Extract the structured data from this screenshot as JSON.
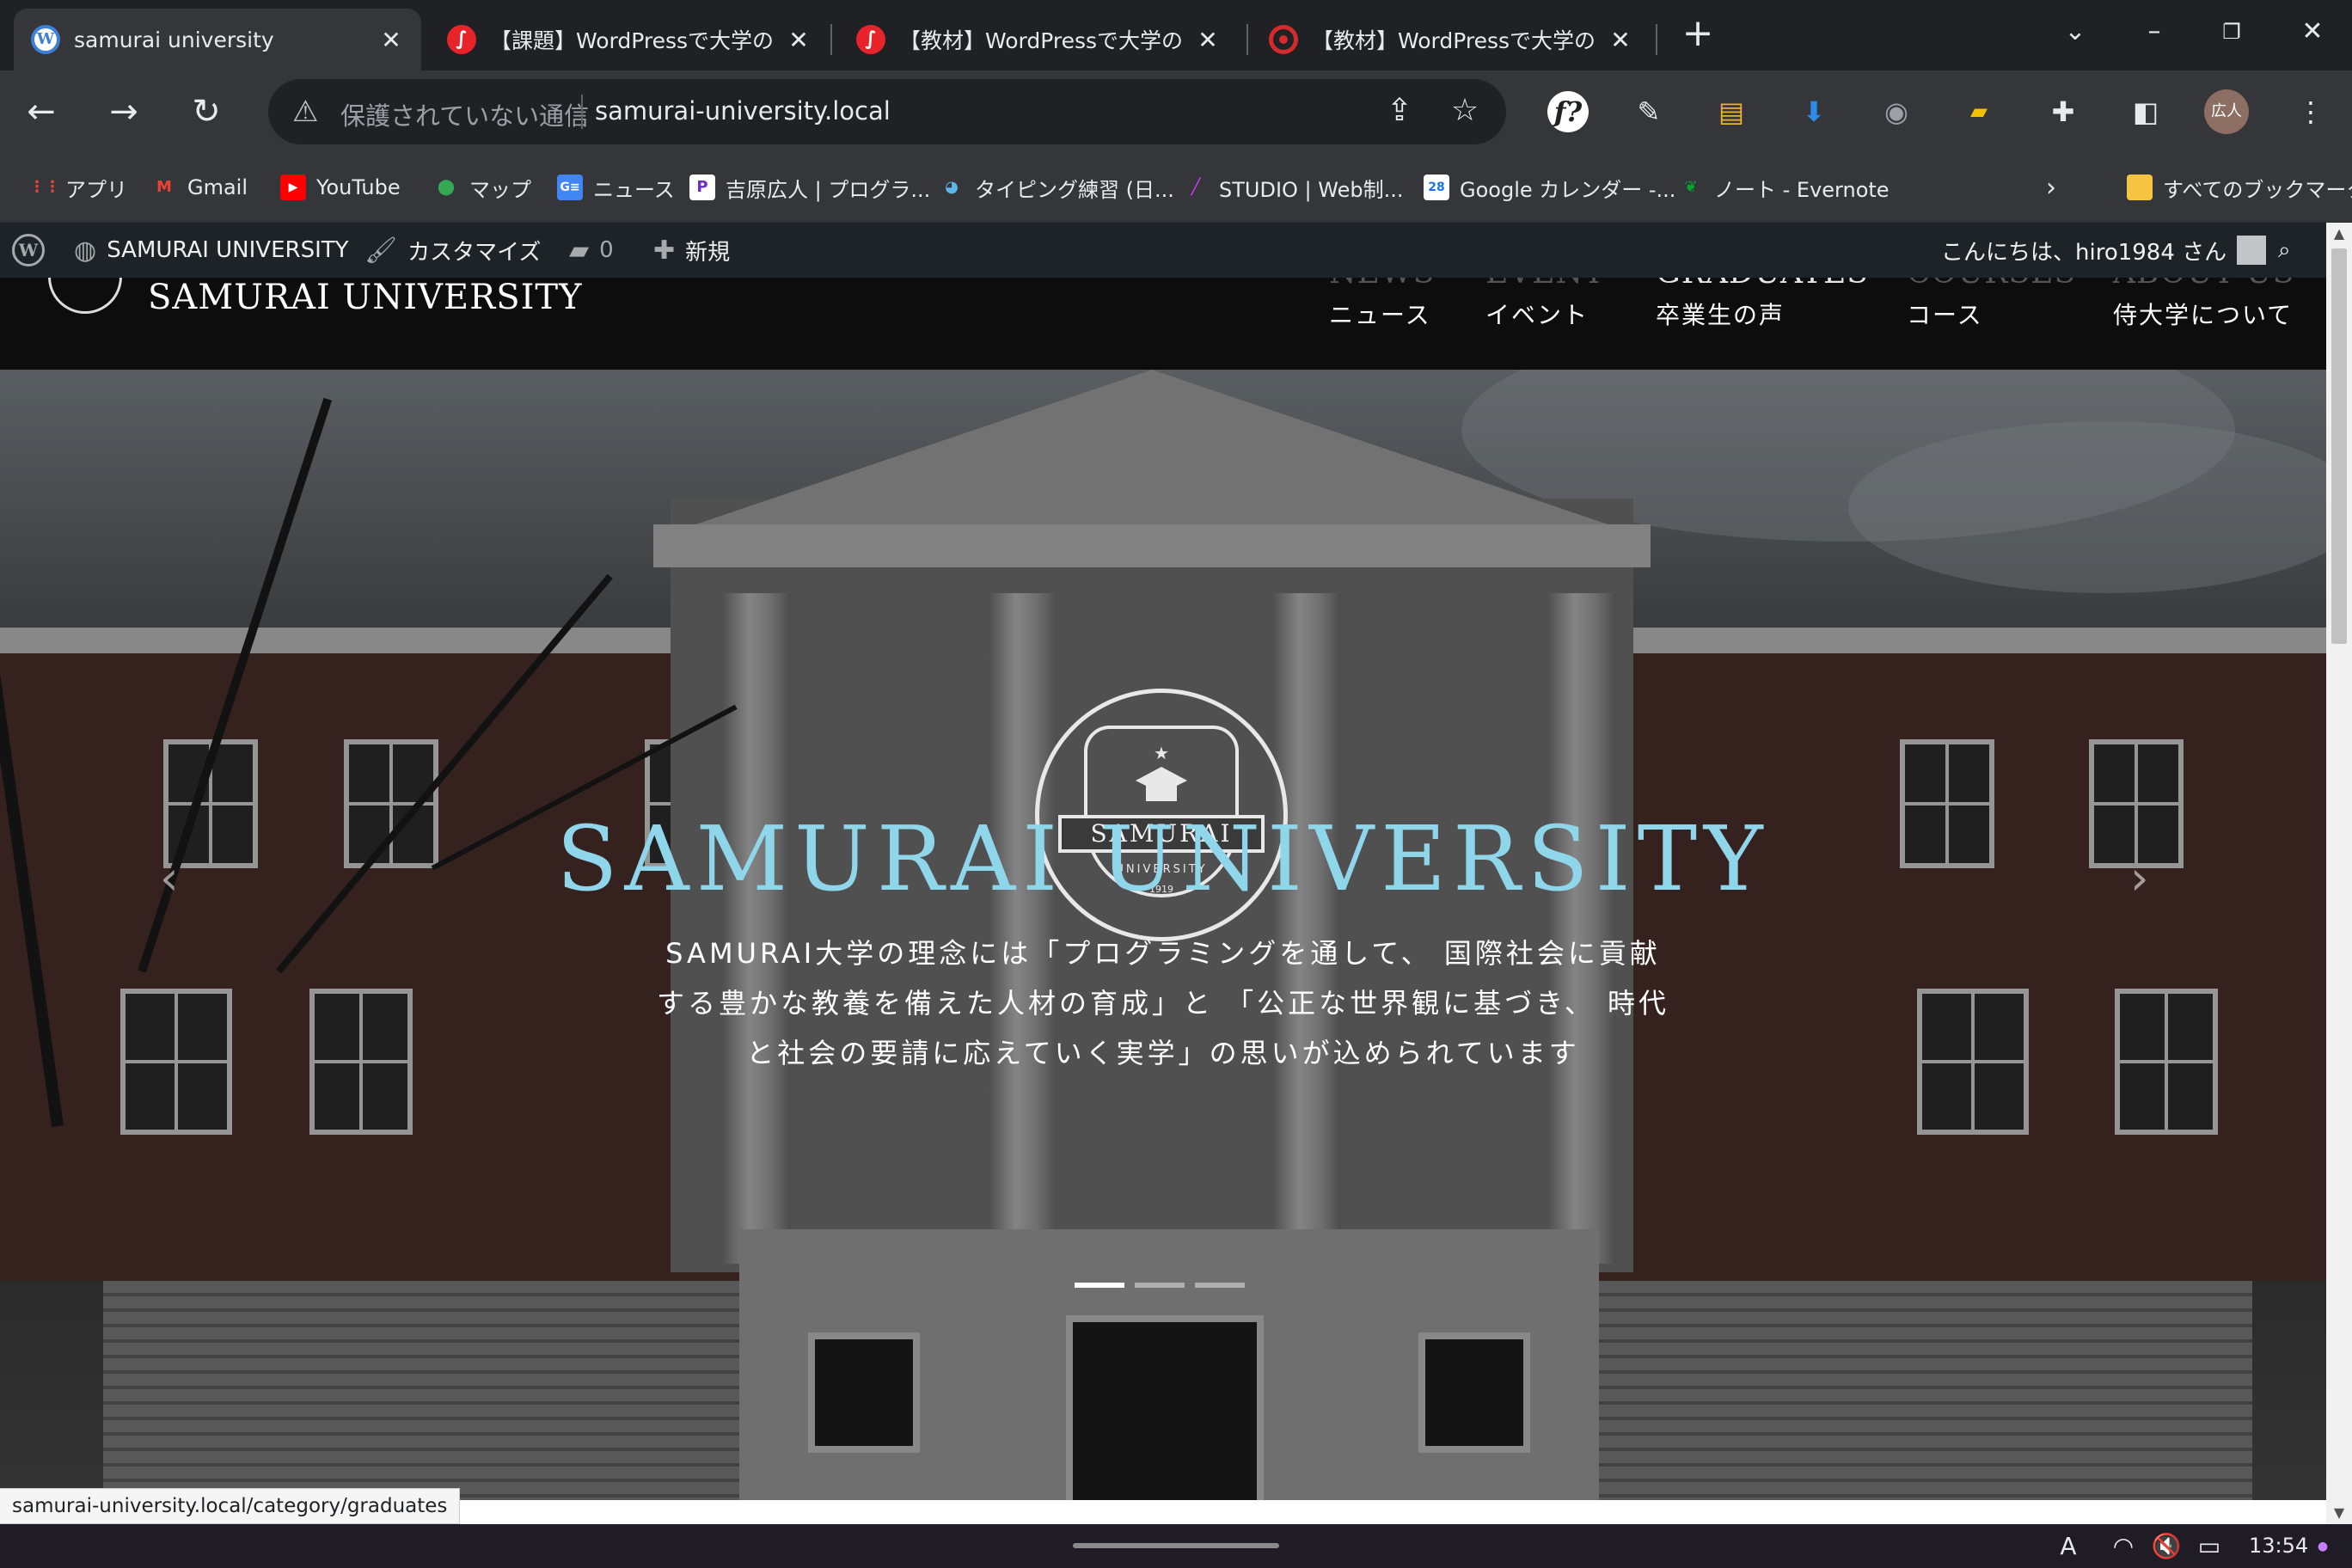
{
  "browser": {
    "tabs": [
      {
        "title": "samurai university",
        "favicon": "wordpress-icon",
        "active": true
      },
      {
        "title": "【課題】WordPressで大学のWe",
        "favicon": "samurai-icon",
        "active": false
      },
      {
        "title": "【教材】WordPressで大学のWe",
        "favicon": "samurai-icon",
        "active": false
      },
      {
        "title": "【教材】WordPressで大学のWe",
        "favicon": "record-icon",
        "active": false
      }
    ],
    "close_glyph": "✕",
    "new_tab_glyph": "+",
    "omnibox": {
      "security_label": "保護されていない通信",
      "url": "samurai-university.local"
    },
    "profile_initials": "広人",
    "bookmarks": [
      {
        "label": "アプリ",
        "icon": "apps-grid-icon"
      },
      {
        "label": "Gmail",
        "icon": "gmail-icon"
      },
      {
        "label": "YouTube",
        "icon": "youtube-icon"
      },
      {
        "label": "マップ",
        "icon": "maps-icon"
      },
      {
        "label": "ニュース",
        "icon": "news-icon"
      },
      {
        "label": "吉原広人 | プログラ...",
        "icon": "p-icon"
      },
      {
        "label": "タイピング練習 (日...",
        "icon": "typing-icon"
      },
      {
        "label": "STUDIO | Web制...",
        "icon": "studio-icon"
      },
      {
        "label": "Google カレンダー -...",
        "icon": "calendar-icon"
      },
      {
        "label": "ノート - Evernote",
        "icon": "evernote-icon"
      },
      {
        "label": "すべてのブックマーク",
        "icon": "folder-icon"
      }
    ],
    "calendar_day": "28"
  },
  "admin_bar": {
    "site_name": "SAMURAI UNIVERSITY",
    "customize": "カスタマイズ",
    "comments_count": "0",
    "new_label": "新規",
    "greeting": "こんにちは、hiro1984 さん"
  },
  "site": {
    "title": "SAMURAI UNIVERSITY",
    "nav": [
      {
        "en": "NEWS",
        "ja": "ニュース",
        "hover": false
      },
      {
        "en": "EVENT",
        "ja": "イベント",
        "hover": false
      },
      {
        "en": "GRADUATES",
        "ja": "卒業生の声",
        "hover": true
      },
      {
        "en": "COURSES",
        "ja": "コース",
        "hover": false
      },
      {
        "en": "ABOUT US",
        "ja": "侍大学について",
        "hover": false
      }
    ],
    "hero": {
      "title": "SAMURAI UNIVERSITY",
      "text_lines": [
        "SAMURAI大学の理念には「プログラミングを通して、 国際社会に貢献",
        "する豊かな教養を備えた人材の育成」と 「公正な世界観に基づき、 時代",
        "と社会の要請に応えていく実学」の思いが込められています"
      ],
      "emblem": {
        "banner": "SAMURAI",
        "sub": "UNIVERSITY",
        "year": "1919"
      },
      "slides": 3,
      "active_slide": 1,
      "title_color": "#8fd6ea"
    }
  },
  "status_bar_url": "samurai-university.local/category/graduates",
  "taskbar": {
    "ime": "A",
    "time": "13:54"
  }
}
